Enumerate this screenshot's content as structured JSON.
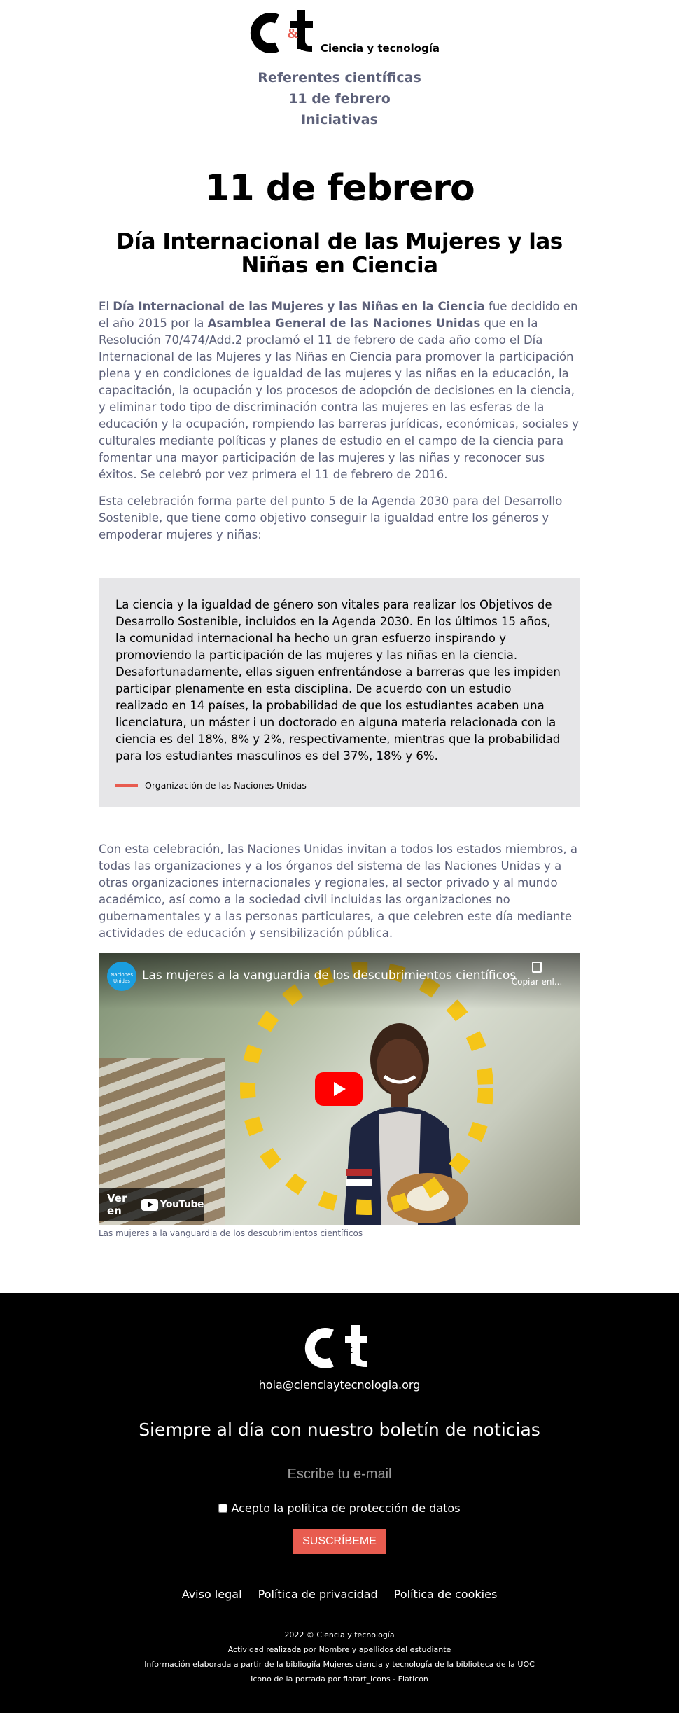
{
  "header": {
    "logo_text": "C&t",
    "logo_suffix": "Ciencia y tecnología",
    "nav": [
      {
        "label": "Referentes científicas"
      },
      {
        "label": "11 de febrero"
      },
      {
        "label": "Iniciativas"
      }
    ]
  },
  "main": {
    "title": "11 de febrero",
    "subtitle": "Día Internacional de las Mujeres y las Niñas en Ciencia",
    "intro": {
      "t1": "El ",
      "b1": "Día Internacional de las Mujeres y las Niñas en la Ciencia",
      "t2": " fue decidido en el año 2015 por la ",
      "b2": "Asamblea General de las Naciones Unidas",
      "t3": " que en la Resolución 70/474/Add.2 proclamó el 11 de febrero de cada año como el Día Internacional de las Mujeres y las Niñas en Ciencia para promover la participación plena y en condiciones de igualdad de las mujeres y las niñas en la educación, la capacitación, la ocupación y los procesos de adopción de decisiones en la ciencia, y eliminar todo tipo de discriminación contra las mujeres en las esferas de la educación y la ocupación, rompiendo las barreras jurídicas, económicas, sociales y culturales mediante políticas y planes de estudio en el campo de la ciencia para fomentar una mayor participación de las mujeres y las niñas y reconocer sus éxitos. Se celebró por vez primera el 11 de febrero de 2016."
    },
    "para2": "Esta celebración forma parte del punto 5 de la Agenda 2030 para del Desarrollo Sostenible, que tiene como objetivo conseguir la igualdad entre los géneros y empoderar mujeres y niñas:",
    "quote": {
      "text": "La ciencia y la igualdad de género son vitales para realizar los Objetivos de Desarrollo Sostenible, incluidos en la Agenda 2030. En los últimos 15 años, la comunidad internacional ha hecho un gran esfuerzo inspirando y promoviendo la participación de las mujeres y las niñas en la ciencia. Desafortunadamente, ellas siguen enfrentándose a barreras que les impiden participar plenamente en esta disciplina. De acuerdo con un estudio realizado en 14 países, la probabilidad de que los estudiantes acaben una licenciatura, un máster i un doctorado en alguna materia relacionada con la ciencia es del 18%, 8% y 2%, respectivamente, mientras que la probabilidad para los estudiantes masculinos es del 37%, 18% y 6%.",
      "cite": "Organización de las Naciones Unidas"
    },
    "para3": "Con esta celebración, las Naciones Unidas invitan a todos los estados miembros, a todas las organizaciones y a los órganos del sistema de las Naciones Unidas y a otras organizaciones internacionales y regionales, al sector privado y al mundo académico, así como a la sociedad civil incluidas las organizaciones no gubernamentales y a las personas particulares, a que celebren este día mediante actividades de educación y sensibilización pública.",
    "video": {
      "channel_logo_text": "Naciones Unidas",
      "title": "Las mujeres a la vanguardia de los descubrimientos científicos",
      "copy_label": "Copiar enl...",
      "watch_label": "Ver en",
      "youtube_label": "YouTube",
      "caption": "Las mujeres a la vanguardia de los descubrimientos científicos"
    }
  },
  "footer": {
    "logo_text": "C&t",
    "email": "hola@cienciaytecnologia.org",
    "newsletter_title": "Siempre al día con nuestro boletín de noticias",
    "email_placeholder": "Escribe tu e-mail",
    "consent_label": "Acepto la política de protección de datos",
    "subscribe_label": "SUSCRÍBEME",
    "legal_links": [
      {
        "label": "Aviso legal"
      },
      {
        "label": "Política de privacidad"
      },
      {
        "label": "Política de cookies"
      }
    ],
    "credits": [
      "2022 © Ciencia y tecnología",
      "Actividad realizada por Nombre y apellidos del estudiante",
      "Información elaborada a partir de la bibliogiía Mujeres ciencia y tecnología de la biblioteca de la UOC",
      "Icono de la portada por flatart_icons - Flaticon"
    ]
  },
  "colors": {
    "accent": "#e85c50",
    "text_muted": "#5c6079",
    "quote_bg": "#e6e6e8",
    "footer_bg": "#000000",
    "dots": "#f5c518"
  }
}
